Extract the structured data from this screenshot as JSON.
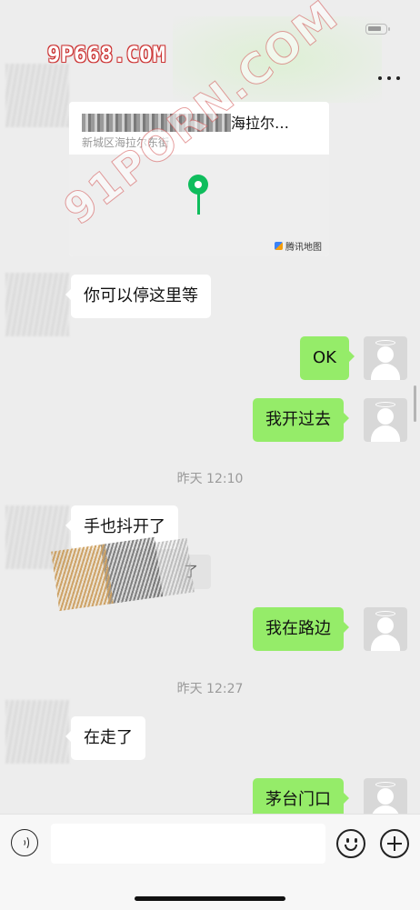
{
  "watermarks": {
    "top": "9P668.COM",
    "diagonal": "91PORN.COM"
  },
  "location_card": {
    "title_suffix": "海拉尔…",
    "address": "新城区海拉尔东街",
    "brand": "腾讯地图"
  },
  "messages": [
    {
      "side": "left",
      "text": "你可以停这里等"
    },
    {
      "side": "right",
      "text": "OK"
    },
    {
      "side": "right",
      "text": "我开过去"
    },
    {
      "type": "time",
      "text": "昨天 12:10"
    },
    {
      "side": "left",
      "text": "手也抖开了"
    },
    {
      "side": "left",
      "text": "了",
      "partially_obscured": true
    },
    {
      "side": "right",
      "text": "我在路边"
    },
    {
      "type": "time",
      "text": "昨天 12:27"
    },
    {
      "side": "left",
      "text": "在走了"
    },
    {
      "side": "right",
      "text": "茅台门口"
    }
  ],
  "input_bar": {
    "placeholder": "",
    "icons": [
      "voice-icon",
      "emoji-icon",
      "plus-icon"
    ]
  },
  "colors": {
    "background": "#ededed",
    "sent_bubble": "#95ec69",
    "received_bubble": "#ffffff",
    "map_pin": "#0fbd5d"
  }
}
